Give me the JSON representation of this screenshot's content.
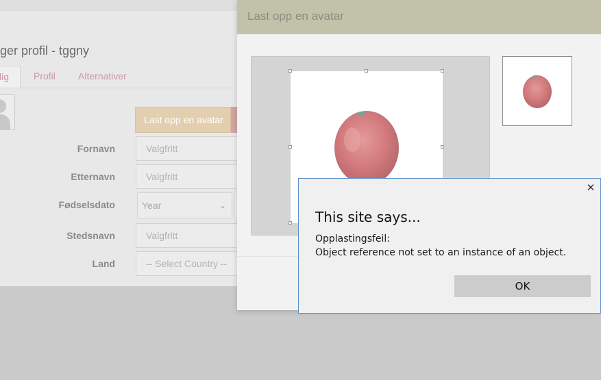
{
  "background_page": {
    "title": "ger profil - tggny",
    "tabs": [
      {
        "label": "lig"
      },
      {
        "label": "Profil"
      },
      {
        "label": "Alternativer"
      }
    ],
    "upload_button_label": "Last opp en avatar",
    "fields": {
      "first_name": {
        "label": "Fornavn",
        "placeholder": "Valgfritt"
      },
      "last_name": {
        "label": "Etternavn",
        "placeholder": "Valgfritt"
      },
      "birth_date": {
        "label": "Fødselsdato",
        "year_placeholder": "Year"
      },
      "place_name": {
        "label": "Stedsnavn",
        "placeholder": "Valgfritt"
      },
      "country": {
        "label": "Land",
        "placeholder": "-- Select Country --"
      }
    }
  },
  "upload_modal": {
    "title": "Last opp en avatar"
  },
  "alert": {
    "title": "This site says...",
    "line1": "Opplastingsfeil:",
    "line2": "Object reference not set to an instance of an object.",
    "ok_label": "OK",
    "close_glyph": "✕"
  },
  "colors": {
    "modal_header": "#c2c2aa",
    "upload_button": "#e3cfb0",
    "tab_link": "#c99aa6",
    "alert_border": "#5b8ec9"
  }
}
